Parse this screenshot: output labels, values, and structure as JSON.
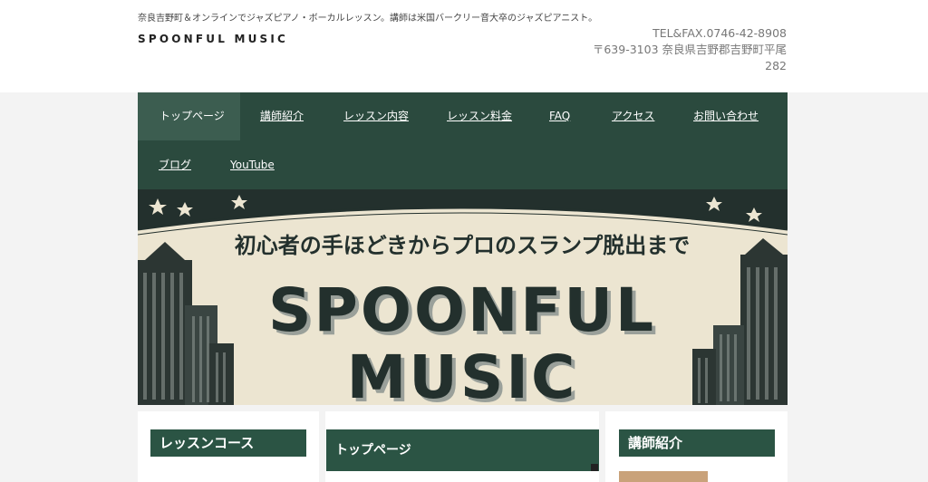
{
  "header": {
    "tagline": "奈良吉野町＆オンラインでジャズピアノ・ボーカルレッスン。講師は米国バークリー音大卒のジャズピアニスト。",
    "site_title": "SPOONFUL MUSIC",
    "contact": {
      "tel_fax": "TEL&FAX.0746-42-8908",
      "address_line1": "〒639-3103 奈良県吉野郡吉野町平尾",
      "address_line2": "282"
    }
  },
  "nav": {
    "items": [
      {
        "label": "トップページ",
        "active": true
      },
      {
        "label": "講師紹介"
      },
      {
        "label": "レッスン内容"
      },
      {
        "label": "レッスン料金"
      },
      {
        "label": "FAQ"
      },
      {
        "label": "アクセス"
      },
      {
        "label": "お問い合わせ"
      },
      {
        "label": "ブログ"
      },
      {
        "label": "YouTube"
      }
    ]
  },
  "hero": {
    "subtitle": "初心者の手ほどきからプロのスランプ脱出まで",
    "title_line1": "SPOONFUL",
    "title_line2": "MUSIC"
  },
  "cards": {
    "left_title": "レッスンコース",
    "center_title": "トップページ",
    "right_title": "講師紹介"
  },
  "colors": {
    "nav_bg": "#2b4a3e",
    "nav_active": "#3c5d50",
    "card_title_bg": "#2b5444",
    "hero_bg": "#ece5d1",
    "hero_dark": "#23302d"
  }
}
